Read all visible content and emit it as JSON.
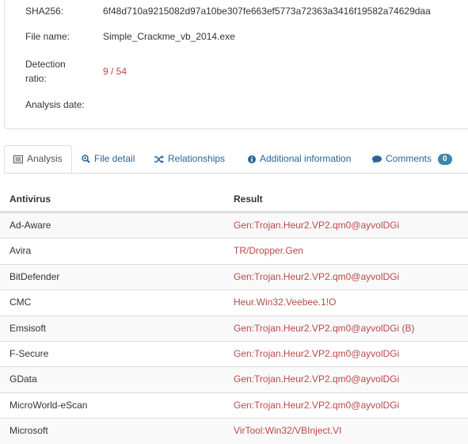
{
  "summary": {
    "sha256_label": "SHA256:",
    "sha256_value": "6f48d710a9215082d97a10be307fe663ef5773a72363a3416f19582a74629daa",
    "filename_label": "File name:",
    "filename_value": "Simple_Crackme_vb_2014.exe",
    "detection_label_1": "Detection",
    "detection_label_2": "ratio:",
    "detection_value": "9 / 54",
    "analysis_date_label": "Analysis date:",
    "detection_color": "#b94a48"
  },
  "tabs": [
    {
      "label": "Analysis",
      "icon": "list-icon",
      "active": true
    },
    {
      "label": "File detail",
      "icon": "zoom-icon"
    },
    {
      "label": "Relationships",
      "icon": "shuffle-icon"
    },
    {
      "label": "Additional information",
      "icon": "info-icon"
    },
    {
      "label": "Comments",
      "icon": "comment-icon",
      "badge": "0"
    }
  ],
  "table": {
    "headers": {
      "antivirus": "Antivirus",
      "result": "Result"
    },
    "rows": [
      {
        "antivirus": "Ad-Aware",
        "result": "Gen:Trojan.Heur2.VP2.qm0@ayvolDGi"
      },
      {
        "antivirus": "Avira",
        "result": "TR/Dropper.Gen"
      },
      {
        "antivirus": "BitDefender",
        "result": "Gen:Trojan.Heur2.VP2.qm0@ayvolDGi"
      },
      {
        "antivirus": "CMC",
        "result": "Heur.Win32.Veebee.1!O"
      },
      {
        "antivirus": "Emsisoft",
        "result": "Gen:Trojan.Heur2.VP2.qm0@ayvolDGi (B)"
      },
      {
        "antivirus": "F-Secure",
        "result": "Gen:Trojan.Heur2.VP2.qm0@ayvolDGi"
      },
      {
        "antivirus": "GData",
        "result": "Gen:Trojan.Heur2.VP2.qm0@ayvolDGi"
      },
      {
        "antivirus": "MicroWorld-eScan",
        "result": "Gen:Trojan.Heur2.VP2.qm0@ayvolDGi"
      },
      {
        "antivirus": "Microsoft",
        "result": "VirTool:Win32/VBInject.VI"
      }
    ]
  },
  "colors": {
    "link": "#2a6496",
    "danger": "#b94a48",
    "badge": "#3a87ad"
  }
}
